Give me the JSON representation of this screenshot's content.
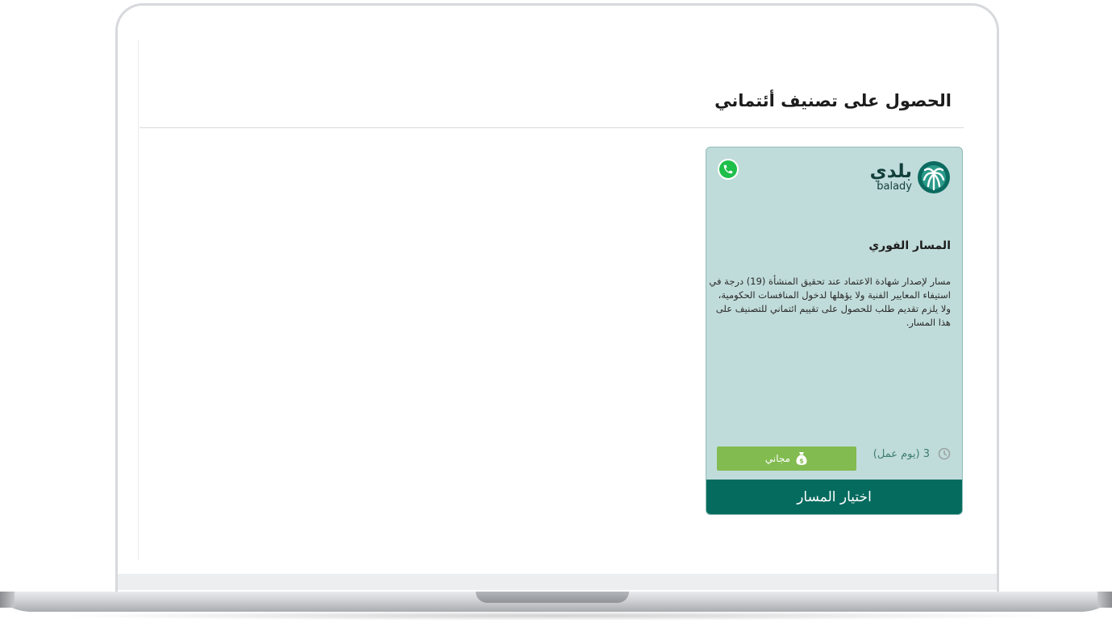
{
  "page": {
    "title": "الحصول على تصنيف أئتماني"
  },
  "card": {
    "logo_ar": "بلدي",
    "logo_en": "balady",
    "title": "المسار الفوري",
    "description": "مسار لإصدار شهادة الاعتماد عند تحقيق المنشأة (19) درجة في استيفاء المعايير الفنية ولا يؤهلها لدخول المنافسات الحكومية، ولا يلزم تقديم طلب للحصول على تقييم ائتماني للتصنيف على هذا المسار.",
    "duration": "3 (يوم عمل)",
    "price_label": "مجاني",
    "select_label": "اختيار المسار"
  },
  "icons": {
    "whatsapp": "whatsapp-icon",
    "logo": "balady-palm-logo",
    "clock": "clock-icon",
    "money_bag": "money-bag-icon"
  },
  "colors": {
    "card_bg": "#c0dcda",
    "primary": "#066b5f",
    "free_button": "#82bb4f",
    "whatsapp": "#1fbf4a"
  }
}
